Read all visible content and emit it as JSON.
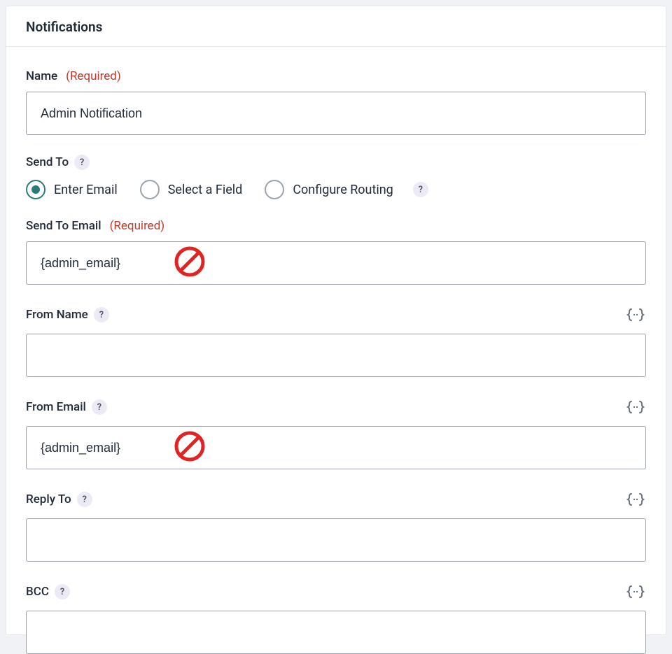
{
  "panel": {
    "title": "Notifications"
  },
  "name": {
    "label": "Name",
    "required_text": "(Required)",
    "value": "Admin Notification"
  },
  "sendTo": {
    "label": "Send To",
    "help": "?",
    "options": [
      {
        "label": "Enter Email",
        "selected": true
      },
      {
        "label": "Select a Field",
        "selected": false
      },
      {
        "label": "Configure Routing",
        "selected": false
      }
    ],
    "routing_help": "?"
  },
  "sendToEmail": {
    "label": "Send To Email",
    "required_text": "(Required)",
    "value": "{admin_email}"
  },
  "fromName": {
    "label": "From Name",
    "help": "?",
    "value": ""
  },
  "fromEmail": {
    "label": "From Email",
    "help": "?",
    "value": "{admin_email}"
  },
  "replyTo": {
    "label": "Reply To",
    "help": "?",
    "value": ""
  },
  "bcc": {
    "label": "BCC",
    "help": "?",
    "value": ""
  }
}
